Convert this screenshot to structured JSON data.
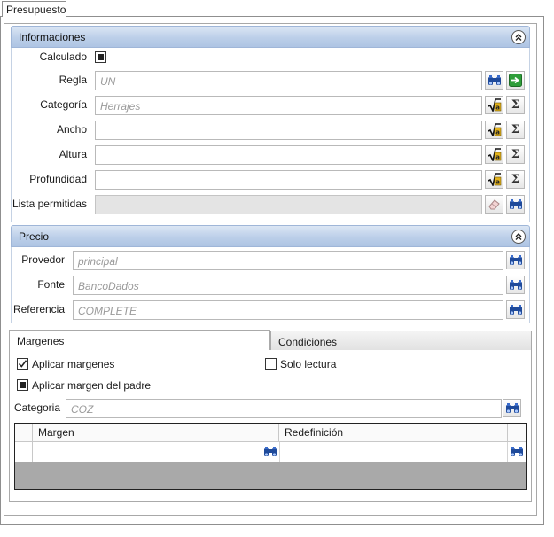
{
  "top_tab": {
    "label": "Presupuesto"
  },
  "informaciones": {
    "title": "Informaciones",
    "calculado_label": "Calculado",
    "regla_label": "Regla",
    "regla_placeholder": "UN",
    "categoria_label": "Categoría",
    "categoria_placeholder": "Herrajes",
    "ancho_label": "Ancho",
    "altura_label": "Altura",
    "profundidad_label": "Profundidad",
    "lista_label": "Lista permitidas"
  },
  "precio": {
    "title": "Precio",
    "provedor_label": "Provedor",
    "provedor_placeholder": "principal",
    "fonte_label": "Fonte",
    "fonte_placeholder": "BancoDados",
    "referencia_label": "Referencia",
    "referencia_placeholder": "COMPLETE"
  },
  "tabs": [
    {
      "label": "Margenes",
      "active": true
    },
    {
      "label": "Condiciones",
      "active": false
    }
  ],
  "margenes": {
    "aplicar_margenes_label": "Aplicar margenes",
    "solo_lectura_label": "Solo lectura",
    "aplicar_padre_label": "Aplicar margen del padre",
    "categoria_label": "Categoria",
    "categoria_placeholder": "COZ",
    "grid": {
      "columns": [
        "Margen",
        "Redefinición"
      ]
    }
  },
  "colors": {
    "header_gradient_top": "#dbe6f4",
    "header_gradient_bottom": "#aec4e3",
    "accent_green": "#2e9e3a",
    "icon_blue": "#1f4a9a"
  },
  "icons": {
    "binoculars": "binoculars-icon",
    "arrow": "green-arrow-icon",
    "sqrt": "formula-icon",
    "sigma": "sigma-icon",
    "eraser": "eraser-icon",
    "collapse": "chevron-up-icon"
  }
}
